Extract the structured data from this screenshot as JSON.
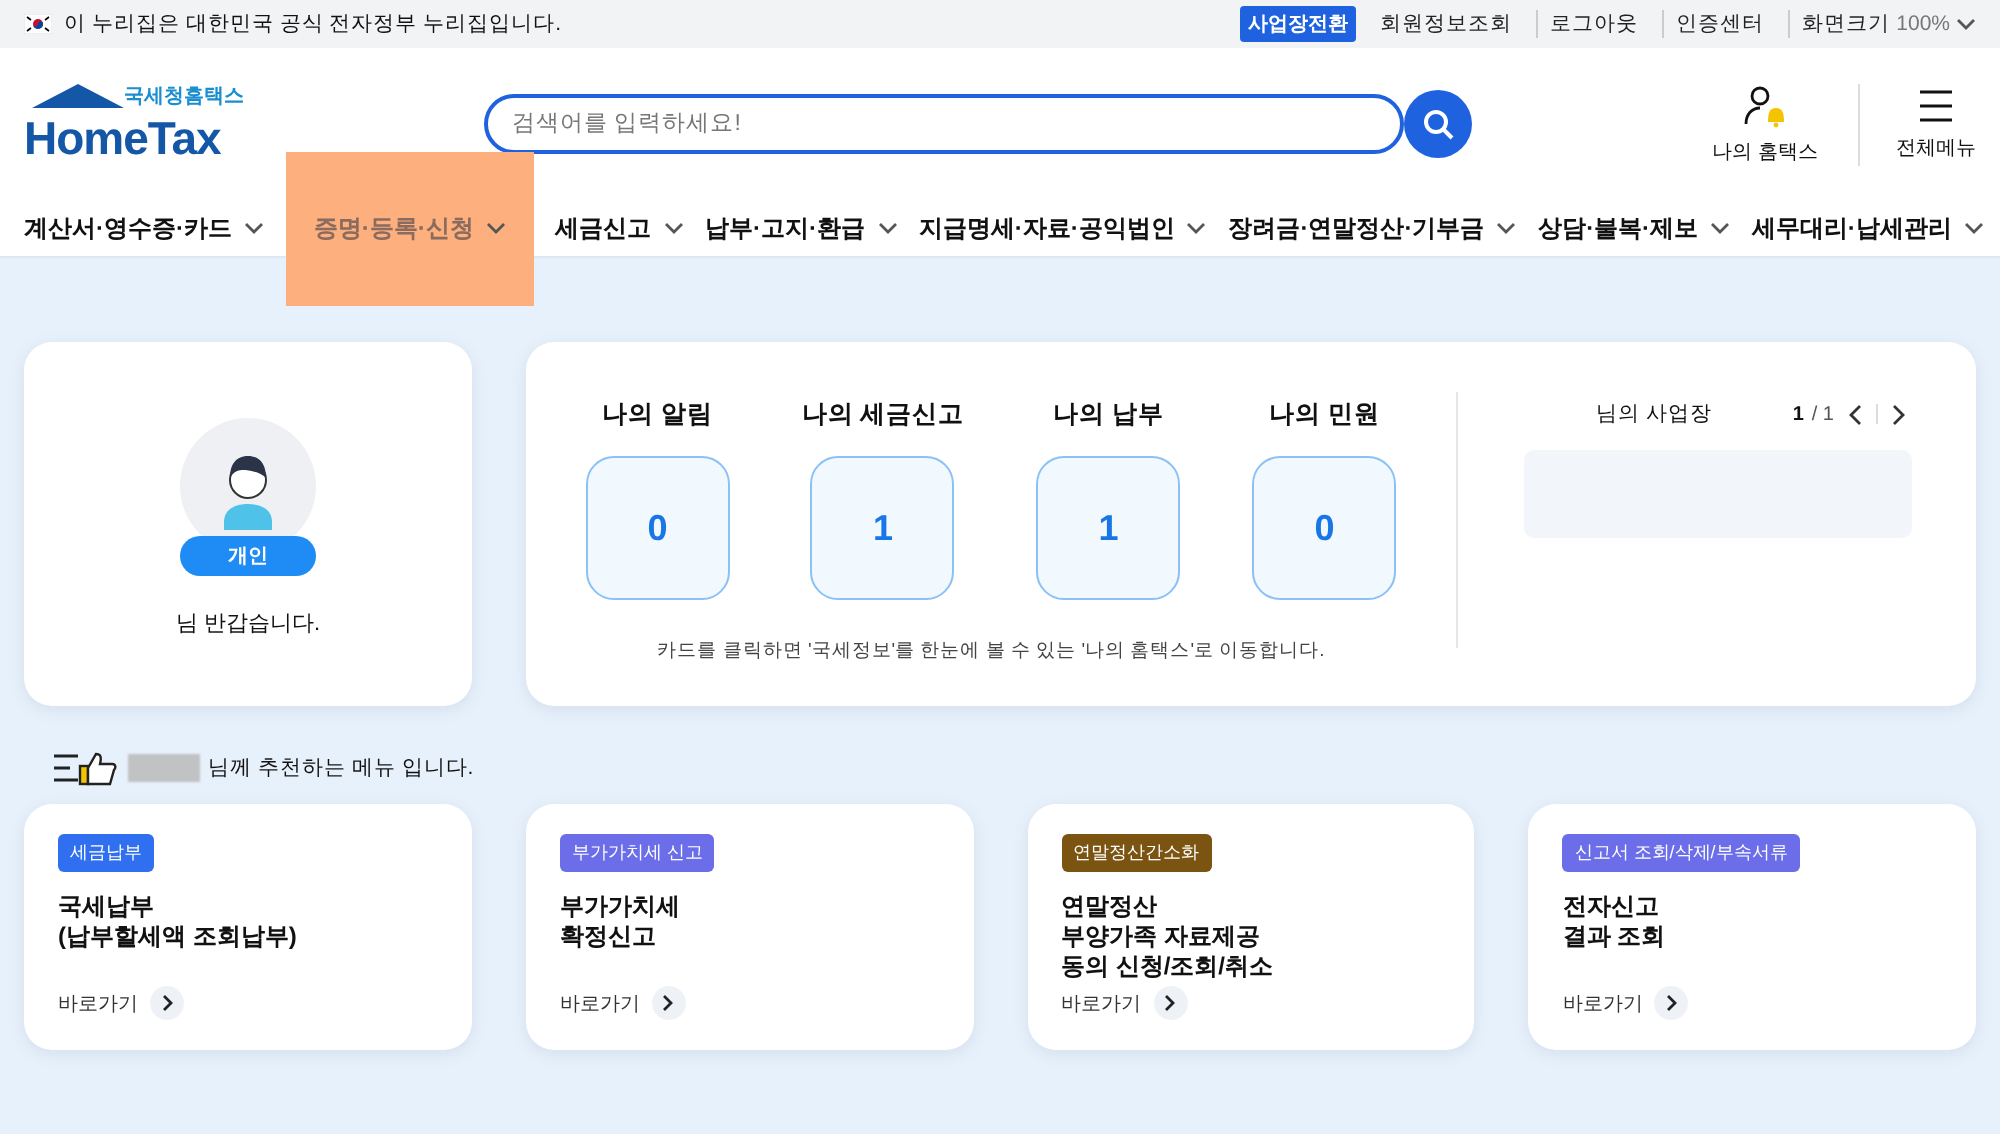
{
  "top_bar": {
    "notice": "이 누리집은 대한민국 공식 전자정부 누리집입니다.",
    "switch_button": "사업장전환",
    "links": [
      "회원정보조회",
      "로그아웃",
      "인증센터"
    ],
    "zoom_label": "화면크기",
    "zoom_value": "100%"
  },
  "header": {
    "logo_small": "국세청홈택스",
    "logo_main": "HomeTax",
    "search": {
      "placeholder": "검색어를 입력하세요!"
    },
    "my_hometax": "나의 홈택스",
    "all_menu": "전체메뉴"
  },
  "nav": [
    {
      "label": "계산서·영수증·카드",
      "selected": false
    },
    {
      "label": "증명·등록·신청",
      "selected": true
    },
    {
      "label": "세금신고",
      "selected": false
    },
    {
      "label": "납부·고지·환급",
      "selected": false
    },
    {
      "label": "지급명세·자료·공익법인",
      "selected": false
    },
    {
      "label": "장려금·연말정산·기부금",
      "selected": false
    },
    {
      "label": "상담·불복·제보",
      "selected": false
    },
    {
      "label": "세무대리·납세관리",
      "selected": false
    }
  ],
  "profile": {
    "badge": "개인",
    "greeting": "님 반갑습니다."
  },
  "summary": {
    "stats": [
      {
        "label": "나의 알림",
        "value": "0"
      },
      {
        "label": "나의 세금신고",
        "value": "1"
      },
      {
        "label": "나의 납부",
        "value": "1"
      },
      {
        "label": "나의 민원",
        "value": "0"
      }
    ],
    "note": "카드를 클릭하면 '국세정보'를 한눈에 볼 수 있는 '나의 홈택스'로 이동합니다.",
    "business": {
      "title": "님의 사업장",
      "page_current": "1",
      "page_total": "/ 1"
    }
  },
  "recommend": {
    "heading": "님께 추천하는 메뉴 입니다.",
    "cards": [
      {
        "tag": "세금납부",
        "color": "#2f6ff0",
        "title": "국세납부\n(납부할세액 조회납부)",
        "link": "바로가기"
      },
      {
        "tag": "부가가치세 신고",
        "color": "#6b6ee8",
        "title": "부가가치세\n확정신고",
        "link": "바로가기"
      },
      {
        "tag": "연말정산간소화",
        "color": "#7a5410",
        "title": "연말정산\n부양가족 자료제공\n동의 신청/조회/취소",
        "link": "바로가기"
      },
      {
        "tag": "신고서 조회/삭제/부속서류",
        "color": "#6b6ee8",
        "title": "전자신고\n결과 조회",
        "link": "바로가기"
      }
    ]
  }
}
